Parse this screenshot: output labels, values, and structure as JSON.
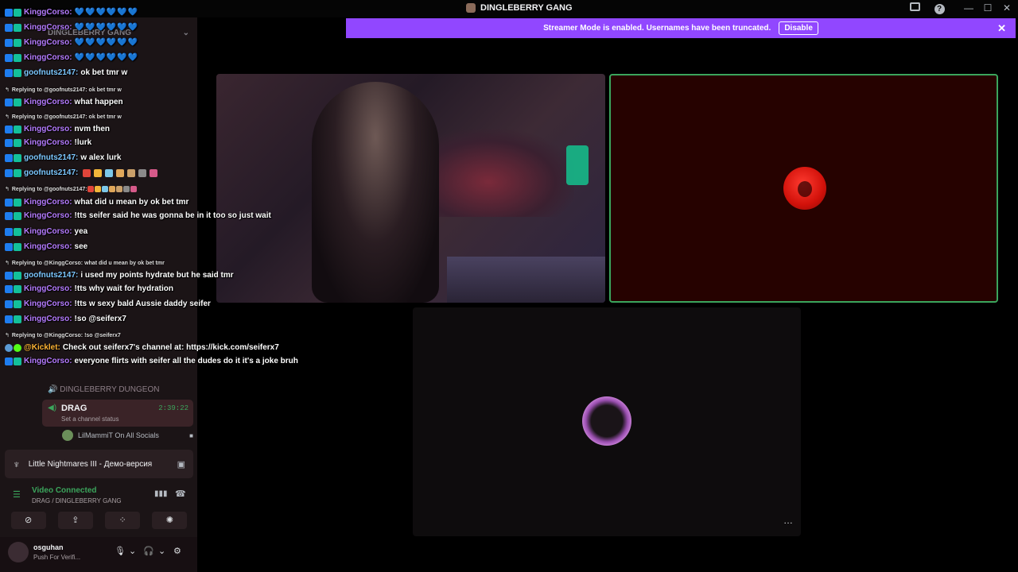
{
  "window": {
    "title": "DINGLEBERRY GANG"
  },
  "banner": {
    "text": "Streamer Mode is enabled. Usernames have been truncated.",
    "button": "Disable",
    "color": "#9147ff"
  },
  "sidebar": {
    "server_name": "DINGLEBERRY GANG",
    "voice_channel": "DINGLEBERRY DUNGEON",
    "active_channel": {
      "name": "DRAG",
      "status": "Set a channel status",
      "elapsed": "2:39:22"
    },
    "member": "LilMammiT On All Socials",
    "activity": "Little Nightmares III - Демо-версия",
    "rtc": {
      "title": "Video Connected",
      "subtitle": "DRAG / DINGLEBERRY GANG"
    },
    "user": {
      "name": "osguhan",
      "status": "Push For Verifi..."
    }
  },
  "chat": {
    "messages": [
      {
        "type": "msg",
        "user": "KinggCorso:",
        "text": "💙💙💙💙💙💙",
        "hearts": true,
        "color": "purple"
      },
      {
        "type": "msg",
        "user": "KinggCorso:",
        "text": "💙💙💙💙💙💙",
        "hearts": true,
        "color": "purple"
      },
      {
        "type": "msg",
        "user": "KinggCorso:",
        "text": "💙💙💙💙💙💙",
        "hearts": true,
        "color": "purple"
      },
      {
        "type": "msg",
        "user": "KinggCorso:",
        "text": "💙💙💙💙💙💙",
        "hearts": true,
        "color": "purple"
      },
      {
        "type": "msg",
        "user": "goofnuts2147:",
        "text": "ok bet tmr w",
        "color": "blue"
      },
      {
        "type": "reply",
        "text": "Replying to @goofnuts2147: ok bet tmr w"
      },
      {
        "type": "msg",
        "user": "KinggCorso:",
        "text": "what happen",
        "color": "purple"
      },
      {
        "type": "reply",
        "text": "Replying to @goofnuts2147: ok bet tmr w"
      },
      {
        "type": "msg",
        "user": "KinggCorso:",
        "text": "nvm then",
        "color": "purple"
      },
      {
        "type": "msg",
        "user": "KinggCorso:",
        "text": "!lurk",
        "color": "purple"
      },
      {
        "type": "msg",
        "user": "goofnuts2147:",
        "text": "w alex lurk",
        "color": "blue"
      },
      {
        "type": "msg",
        "user": "goofnuts2147:",
        "text": "",
        "emotes": 7,
        "color": "blue"
      },
      {
        "type": "reply",
        "text": "Replying to @goofnuts2147:",
        "emotes": 7
      },
      {
        "type": "msg",
        "user": "KinggCorso:",
        "text": "what did u mean by ok bet tmr",
        "color": "purple"
      },
      {
        "type": "msg",
        "user": "KinggCorso:",
        "text": "!tts seifer said he was gonna be in it too so just wait",
        "color": "purple"
      },
      {
        "type": "msg",
        "user": "KinggCorso:",
        "text": "yea",
        "color": "purple"
      },
      {
        "type": "msg",
        "user": "KinggCorso:",
        "text": "see",
        "color": "purple"
      },
      {
        "type": "reply",
        "text": "Replying to @KinggCorso: what did u mean by ok bet tmr"
      },
      {
        "type": "msg",
        "user": "goofnuts2147:",
        "text": "i used my points hydrate but he said tmr",
        "color": "blue"
      },
      {
        "type": "msg",
        "user": "KinggCorso:",
        "text": "!tts why wait for hydration",
        "color": "purple"
      },
      {
        "type": "msg",
        "user": "KinggCorso:",
        "text": "!tts w sexy bald Aussie daddy seifer",
        "color": "purple"
      },
      {
        "type": "msg",
        "user": "KinggCorso:",
        "text": "!so @seiferx7",
        "color": "purple"
      },
      {
        "type": "reply",
        "text": "Replying to @KinggCorso: !so @seiferx7"
      },
      {
        "type": "msg",
        "user": "@Kicklet:",
        "text": "Check out seiferx7's channel at: https://kick.com/seiferx7",
        "color": "gold",
        "bot": true
      },
      {
        "type": "msg",
        "user": "KinggCorso:",
        "text": "everyone flirts with seifer all the dudes do it it's a joke bruh",
        "color": "purple"
      }
    ]
  },
  "tiles": {
    "remote_border_color": "#3ba55c",
    "more_label": "…"
  },
  "icons": {
    "help": "?",
    "minimize": "—",
    "maximize": "☐",
    "close": "✕"
  }
}
